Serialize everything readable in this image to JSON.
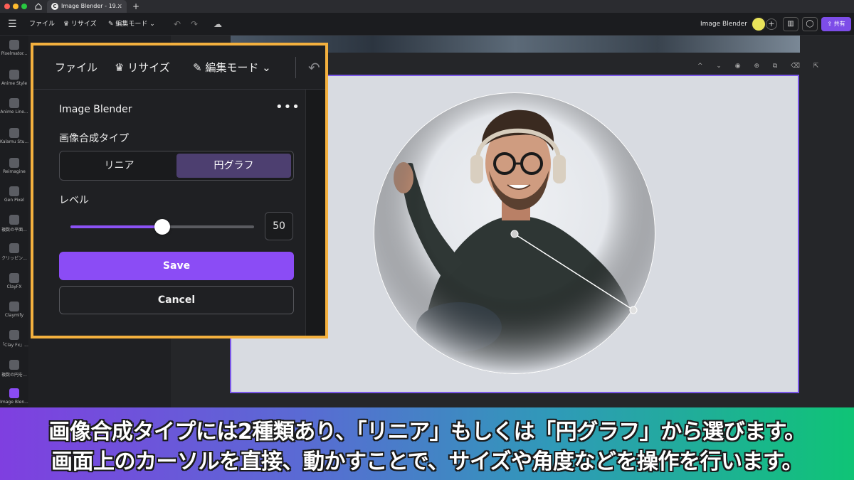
{
  "browser": {
    "tab_title": "Image Blender - 19...",
    "tab_close": "×",
    "new_tab": "+",
    "favicon_letter": "C"
  },
  "toolbar": {
    "menu_icon": "☰",
    "file": "ファイル",
    "resize": "♛ リサイズ",
    "edit_mode": "✎ 編集モード ⌄",
    "undo": "↶",
    "redo": "↷",
    "cloud": "☁",
    "app_title": "Image Blender",
    "add": "+",
    "stats": "▥",
    "comment": "◯",
    "share": "⇪ 共有"
  },
  "rail": {
    "items": [
      {
        "label": "Pixelmator..."
      },
      {
        "label": "Anime Style"
      },
      {
        "label": "Anime Line..."
      },
      {
        "label": "Kalamu Stu..."
      },
      {
        "label": "Reimagine"
      },
      {
        "label": "Gen Pixel"
      },
      {
        "label": "複数の平面..."
      },
      {
        "label": "クリッピン..."
      },
      {
        "label": "ClayFX"
      },
      {
        "label": "Claymify"
      },
      {
        "label": "「Clay Fx」..."
      },
      {
        "label": "複数の円を..."
      },
      {
        "label": "Image Blen..."
      }
    ],
    "peek_texts": [
      "r...",
      "yle",
      "e...",
      "u...",
      "ne"
    ]
  },
  "page_controls": "^ ⌄ ◉ ⊕ ⧉ ⌫ ⇱",
  "panel": {
    "toolbar": {
      "file": "ファイル",
      "crown": "♛",
      "resize": "リサイズ",
      "edit_mode": "✎ 編集モード ⌄",
      "undo": "↶"
    },
    "app_title": "Image Blender",
    "more": "•••",
    "type_label": "画像合成タイプ",
    "options": {
      "linear": "リニア",
      "pie": "円グラフ"
    },
    "selected_option": "円グラフ",
    "level_label": "レベル",
    "level": {
      "value": 50,
      "min": 0,
      "max": 100,
      "display": "50"
    },
    "save": "Save",
    "cancel": "Cancel"
  },
  "caption": {
    "line1": "画像合成タイプには2種類あり、「リニア」もしくは「円グラフ」から選びます。",
    "line2": "画面上のカーソルを直接、動かすことで、サイズや角度などを操作を行います。"
  },
  "colors": {
    "accent": "#8b4cf5",
    "callout_border": "#f3b03e",
    "selected_segment": "#4d3f70"
  }
}
